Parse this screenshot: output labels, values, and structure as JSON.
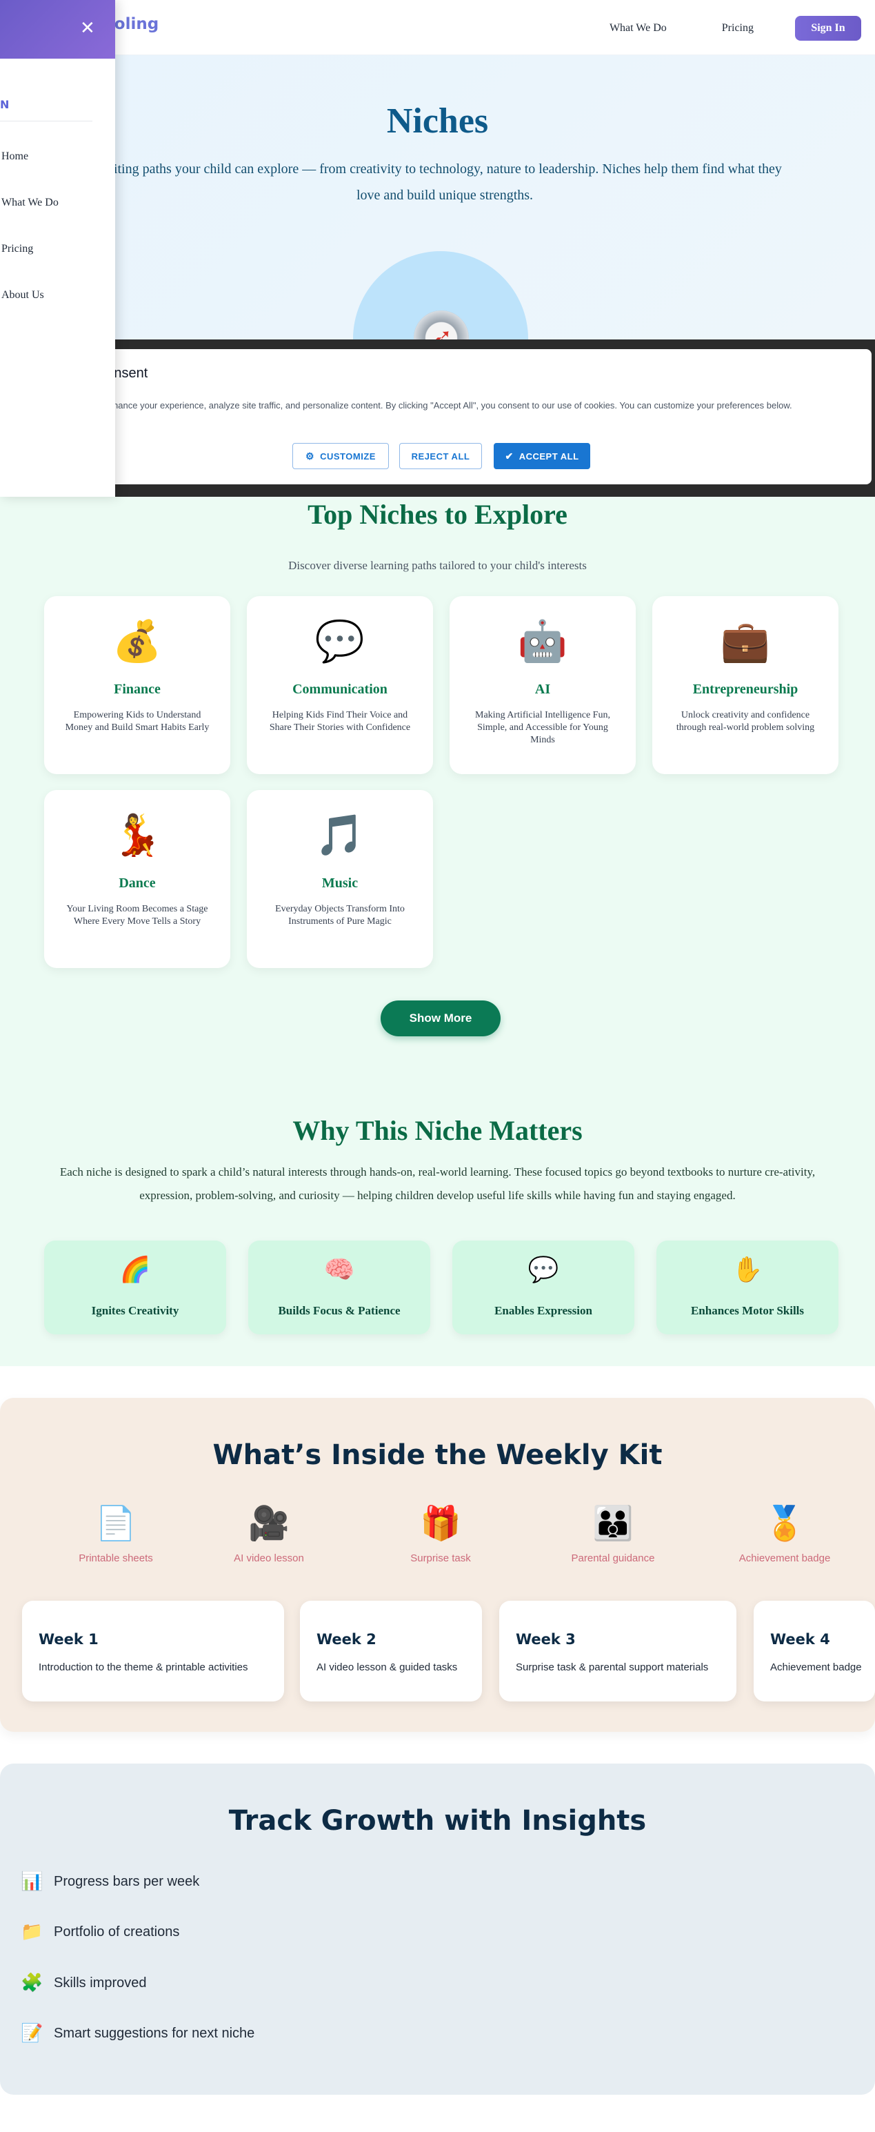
{
  "header": {
    "brand": "ooling",
    "nav": [
      "What We Do",
      "Pricing"
    ],
    "signin": "Sign In"
  },
  "hero": {
    "title": "Niches",
    "text": "citing paths your child can explore — from creativity to technology, nature to leadership. Niches help them find what they love and build unique strengths.",
    "icon": "compass-icon"
  },
  "cookie": {
    "title": "Cookie Consent",
    "text": "We use cookies to enhance your experience, analyze site traffic, and personalize content. By clicking \"Accept All\", you consent to our use of cookies. You can customize your preferences below.",
    "customize": "CUSTOMIZE",
    "reject": "REJECT ALL",
    "accept": "ACCEPT ALL",
    "accent": "#1976d2"
  },
  "drawer": {
    "login": "N",
    "links": [
      "Home",
      "What We Do",
      "Pricing",
      "About Us"
    ]
  },
  "niches": {
    "title": "Top Niches to Explore",
    "subtitle": "Discover diverse learning paths tailored to your child's interests",
    "cards": [
      {
        "icon": "💰",
        "title": "Finance",
        "desc": "Empowering Kids to Understand Money and Build Smart Habits Early"
      },
      {
        "icon": "💬",
        "title": "Communication",
        "desc": "Helping Kids Find Their Voice and Share Their Stories with Confidence"
      },
      {
        "icon": "🤖",
        "title": "AI",
        "desc": "Making Artificial Intelligence Fun, Simple, and Accessible for Young Minds"
      },
      {
        "icon": "💼",
        "title": "Entrepreneurship",
        "desc": "Unlock creativity and confidence through real-world problem solving"
      },
      {
        "icon": "💃",
        "title": "Dance",
        "desc": "Your Living Room Becomes a Stage Where Every Move Tells a Story"
      },
      {
        "icon": "🎵",
        "title": "Music",
        "desc": "Everyday Objects Transform Into Instruments of Pure Magic"
      }
    ],
    "show_more": "Show More"
  },
  "why": {
    "title": "Why This Niche Matters",
    "text": "Each niche is designed to spark a child’s natural interests through hands-on, real-world learning. These focused topics go beyond textbooks to nurture cre-ativity, expression, problem-solving, and curiosity — helping children develop useful life skills while having fun and staying engaged.",
    "benefits": [
      {
        "icon": "🌈",
        "label": "Ignites Creativity"
      },
      {
        "icon": "🧠",
        "label": "Builds Focus & Patience"
      },
      {
        "icon": "💬",
        "label": "Enables Expression"
      },
      {
        "icon": "✋",
        "label": "Enhances Motor Skills"
      }
    ]
  },
  "kit": {
    "title": "What’s Inside the Weekly Kit",
    "items": [
      {
        "icon": "📄",
        "label": "Printable sheets"
      },
      {
        "icon": "🎥",
        "label": "AI video lesson"
      },
      {
        "icon": "🎁",
        "label": "Surprise task"
      },
      {
        "icon": "👪",
        "label": "Parental guidance"
      },
      {
        "icon": "🏅",
        "label": "Achievement badge"
      }
    ],
    "weeks": [
      {
        "title": "Week 1",
        "desc": "Introduction to the theme & printable activities"
      },
      {
        "title": "Week 2",
        "desc": "AI video lesson & guided tasks"
      },
      {
        "title": "Week 3",
        "desc": "Surprise task & parental support materials"
      },
      {
        "title": "Week 4",
        "desc": "Achievement badge"
      }
    ]
  },
  "track": {
    "title": "Track Growth with Insights",
    "items": [
      {
        "icon": "📊",
        "label": "Progress bars per week"
      },
      {
        "icon": "📁",
        "label": "Portfolio of creations"
      },
      {
        "icon": "🧩",
        "label": "Skills improved"
      },
      {
        "icon": "📝",
        "label": "Smart suggestions for next niche"
      }
    ]
  }
}
